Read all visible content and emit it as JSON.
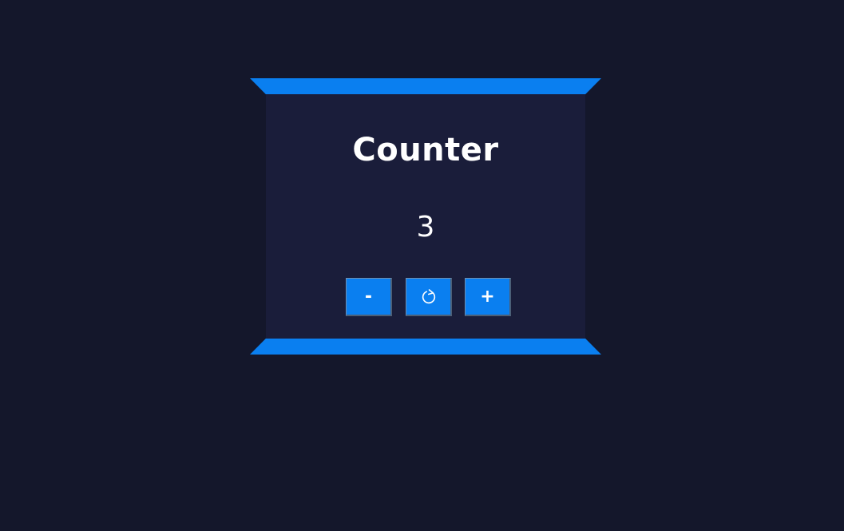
{
  "counter": {
    "title": "Counter",
    "value": "3"
  },
  "buttons": {
    "decrement_label": "-",
    "reset_icon": "refresh-icon",
    "increment_label": "+"
  },
  "colors": {
    "background": "#14172b",
    "panel": "#1a1d3a",
    "accent": "#0a7ff0",
    "text": "#ffffff"
  }
}
